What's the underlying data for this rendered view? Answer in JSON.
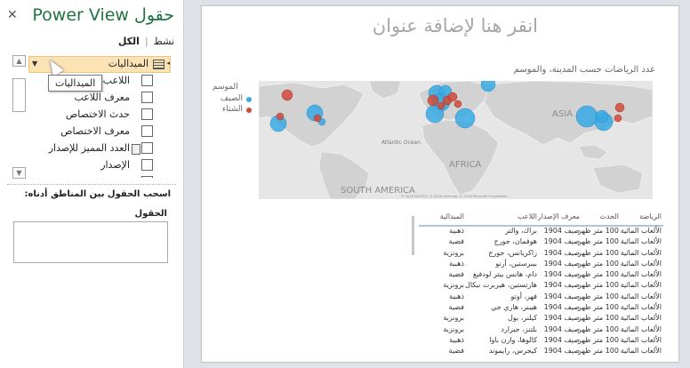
{
  "field_pane": {
    "title": "حقول Power View",
    "close_label": "✕",
    "tab_active": "نشط",
    "tab_all": "الكل",
    "table_name": "الميداليات",
    "tooltip": "الميداليات",
    "fields": [
      {
        "label": "اللاعب",
        "calc": false
      },
      {
        "label": "معرف اللاعب",
        "calc": false
      },
      {
        "label": "حدث الاختصاص",
        "calc": false
      },
      {
        "label": "معرف الاختصاص",
        "calc": false
      },
      {
        "label": "العدد المميز للإصدار",
        "calc": true
      },
      {
        "label": "الإصدار",
        "calc": false
      },
      {
        "label": "",
        "calc": false
      }
    ],
    "drag_hint": "اسحب الحقول بين المناطق أدناه:",
    "fields_area_label": "الحقول"
  },
  "canvas": {
    "title": "انقر هنا لإضافة عنوان",
    "map_title": "عدد الرياضات حسب المدينة، والموسم",
    "legend": {
      "title": "الموسم",
      "items": [
        {
          "label": "الصيف",
          "color": "#3aa9e4"
        },
        {
          "label": "الشتاء",
          "color": "#d24a3b"
        }
      ]
    },
    "map_labels": {
      "atlantic": "Atlantic Ocean",
      "africa": "AFRICA",
      "asia": "ASIA",
      "south_america": "SOUTH AMERICA",
      "copyright": "© 2016 NAVTEQ, © 2016 Intermap, © 2016 Microsoft Corporation"
    }
  },
  "table": {
    "headers": [
      "الرياضة",
      "الحدث",
      "معرف الإصدار",
      "اللاعب",
      "الميدالية"
    ],
    "rows": [
      [
        "الألعاب المائية",
        "100 متر ظهر",
        "صيف 1904",
        "براك، والتر",
        "ذهبية"
      ],
      [
        "الألعاب المائية",
        "100 متر ظهر",
        "صيف 1904",
        "هوفمان، جورج",
        "فضية"
      ],
      [
        "الألعاب المائية",
        "100 متر ظهر",
        "صيف 1904",
        "زاكريانس، جورج",
        "برونزية"
      ],
      [
        "الألعاب المائية",
        "100 متر ظهر",
        "صيف 1904",
        "بيبرستين، أرنو",
        "ذهبية"
      ],
      [
        "الألعاب المائية",
        "100 متر ظهر",
        "صيف 1904",
        "دام، هانس بيتر لودفيغ",
        "فضية"
      ],
      [
        "الألعاب المائية",
        "100 متر ظهر",
        "صيف 1904",
        "هارتستين، هيربرت نيكال",
        "برونزية"
      ],
      [
        "الألعاب المائية",
        "100 متر ظهر",
        "صيف 1904",
        "فهر، أوتو",
        "ذهبية"
      ],
      [
        "الألعاب المائية",
        "100 متر ظهر",
        "صيف 1904",
        "هيبنر، هاري جي",
        "فضية"
      ],
      [
        "الألعاب المائية",
        "100 متر ظهر",
        "صيف 1904",
        "كيلنر، بول",
        "برونزية"
      ],
      [
        "الألعاب المائية",
        "100 متر ظهر",
        "صيف 1904",
        "بلتنز، جيرارد",
        "برونزية"
      ],
      [
        "الألعاب المائية",
        "100 متر ظهر",
        "صيف 1904",
        "كالوها، وارن باوا",
        "ذهبية"
      ],
      [
        "الألعاب المائية",
        "100 متر ظهر",
        "صيف 1904",
        "كيجرس، رايموند",
        "فضية"
      ]
    ]
  }
}
